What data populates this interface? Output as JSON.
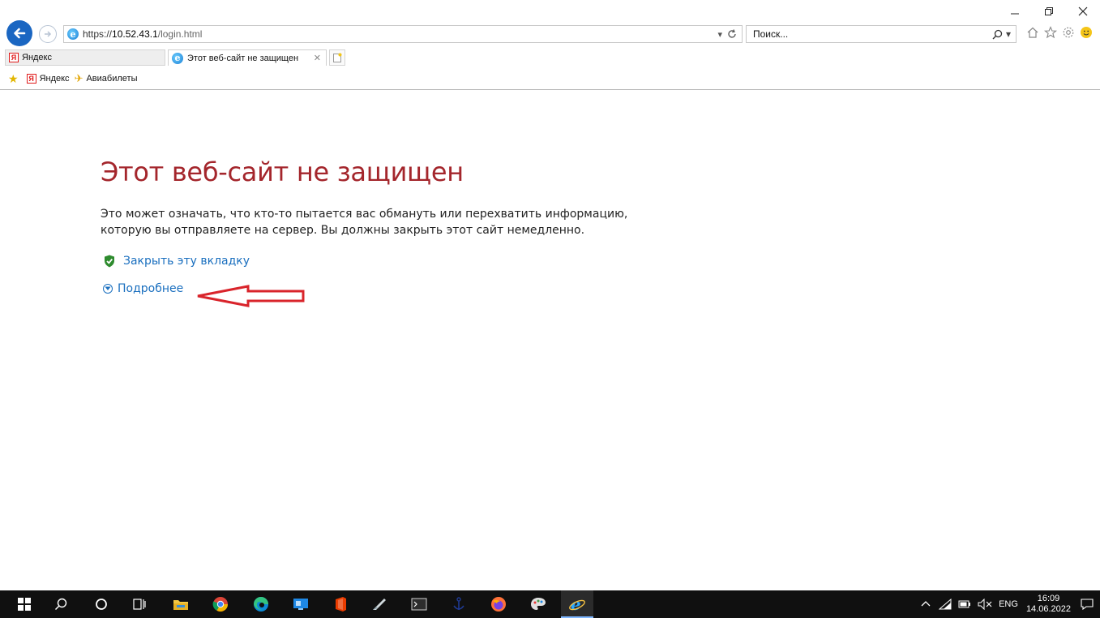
{
  "browser": {
    "url_scheme": "https://",
    "url_host": "10.52.43.1",
    "url_path": "/login.html",
    "search_placeholder": "Поиск...",
    "tabs": [
      {
        "label": "Яндекс",
        "active": false
      },
      {
        "label": "Этот веб-сайт не защищен",
        "active": true
      }
    ],
    "favorites": [
      {
        "label": "Яндекс"
      },
      {
        "label": "Авиабилеты"
      }
    ]
  },
  "page": {
    "title": "Этот веб-сайт не защищен",
    "description": "Это может означать, что кто-то пытается вас обмануть или перехватить информацию, которую вы отправляете на сервер. Вы должны закрыть этот сайт немедленно.",
    "close_tab_label": "Закрыть эту вкладку",
    "more_info_label": "Подробнее",
    "annotation_color": "#d9242b"
  },
  "taskbar": {
    "language": "ENG",
    "time": "16:09",
    "date": "14.06.2022"
  },
  "colors": {
    "title_red": "#a4262c",
    "link_blue": "#1a6fbf",
    "ie_blue": "#1a66c2"
  }
}
